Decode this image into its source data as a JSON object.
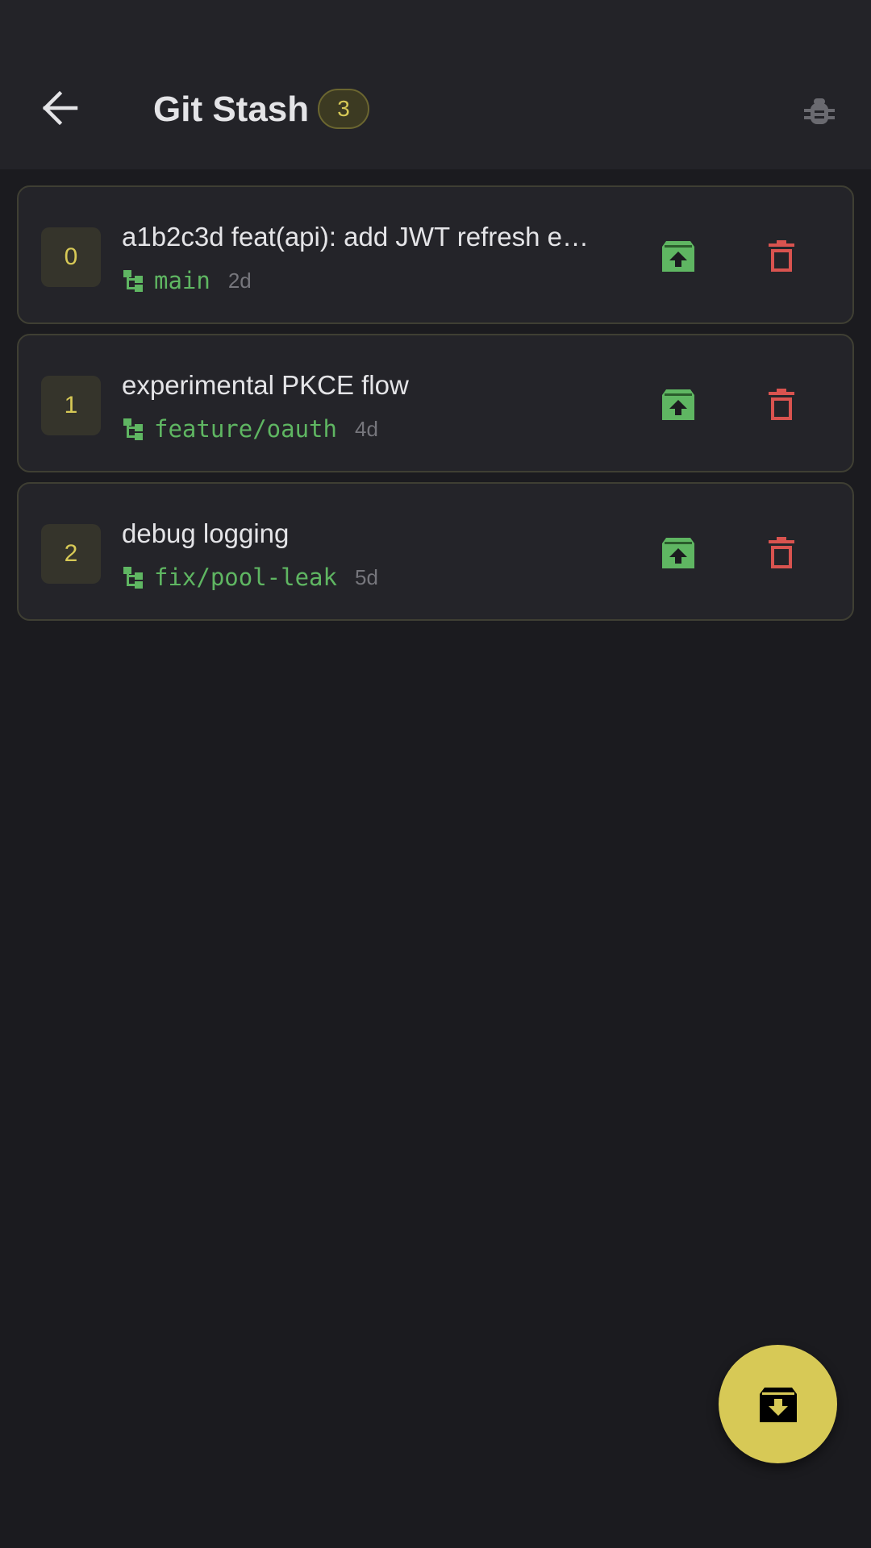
{
  "header": {
    "title": "Git Stash",
    "count": "3",
    "icons": {
      "back": "arrow-left-icon",
      "debug": "bug-icon"
    }
  },
  "stashes": [
    {
      "index": "0",
      "message": "a1b2c3d feat(api): add JWT refresh e…",
      "branch": "main",
      "age": "2d"
    },
    {
      "index": "1",
      "message": "experimental PKCE flow",
      "branch": "feature/oauth",
      "age": "4d"
    },
    {
      "index": "2",
      "message": "debug logging",
      "branch": "fix/pool-leak",
      "age": "5d"
    }
  ],
  "icons": {
    "branch": "branch-tree-icon",
    "apply": "archive-upload-icon",
    "drop": "trash-icon",
    "fab": "archive-download-icon"
  },
  "colors": {
    "accent": "#d7c956",
    "branch": "#5fb662",
    "apply": "#5fb662",
    "drop": "#d9534f",
    "background": "#1b1b1f",
    "appbar": "#232328"
  }
}
